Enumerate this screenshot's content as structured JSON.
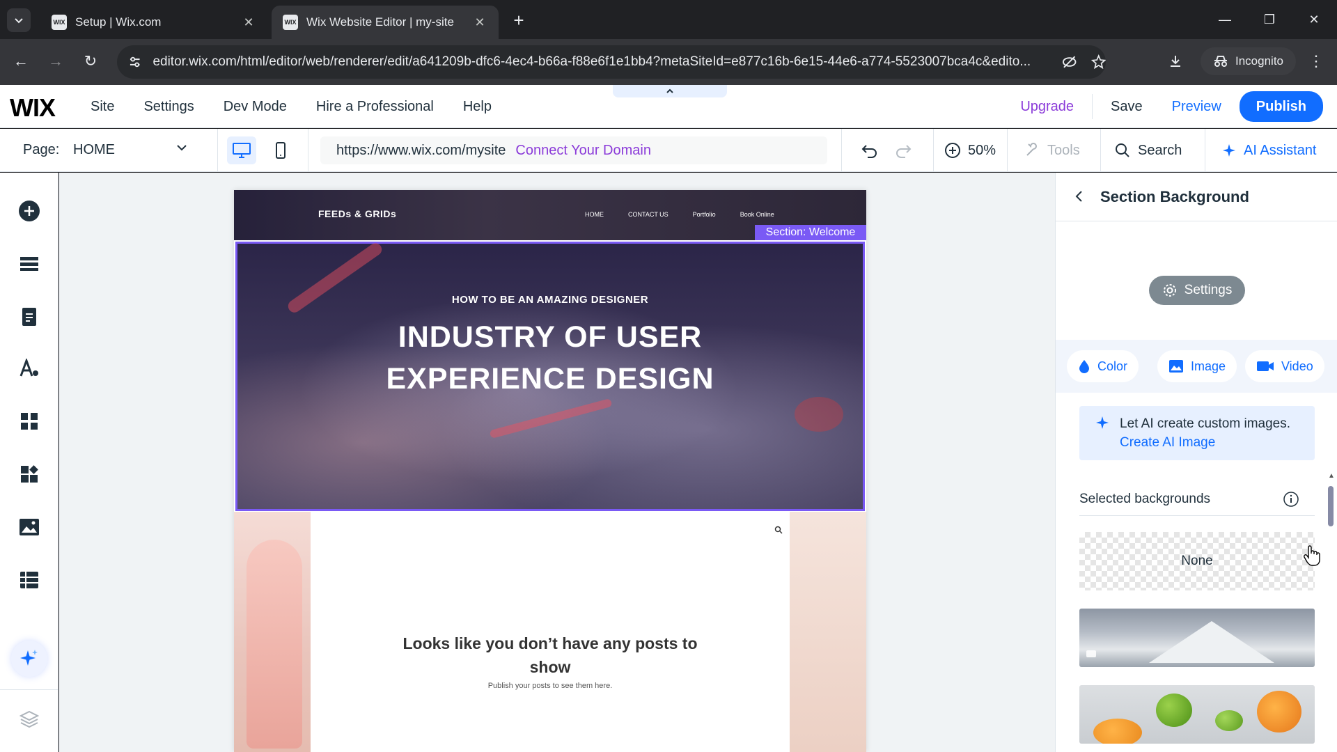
{
  "browser": {
    "tabs": [
      {
        "title": "Setup | Wix.com",
        "active": false
      },
      {
        "title": "Wix Website Editor | my-site",
        "active": true
      }
    ],
    "url": "editor.wix.com/html/editor/web/renderer/edit/a641209b-dfc6-4ec4-b66a-f88e6f1e1bb4?metaSiteId=e877c16b-6e15-44e6-a774-5523007bca4c&edito...",
    "incognito_label": "Incognito"
  },
  "wix_top": {
    "logo": "WIX",
    "menu": [
      "Site",
      "Settings",
      "Dev Mode",
      "Hire a Professional",
      "Help"
    ],
    "upgrade": "Upgrade",
    "save": "Save",
    "preview": "Preview",
    "publish": "Publish"
  },
  "wix_bar2": {
    "page_label": "Page:",
    "page_value": "HOME",
    "site_url": "https://www.wix.com/mysite",
    "connect_domain": "Connect Your Domain",
    "zoom": "50%",
    "tools": "Tools",
    "search": "Search",
    "ai_assistant": "AI Assistant"
  },
  "site": {
    "logo": "FEEDs & GRIDs",
    "nav": [
      "HOME",
      "CONTACT US",
      "Portfolio",
      "Book Online"
    ],
    "section_tag": "Section: Welcome",
    "hero_subtitle": "HOW TO BE AN AMAZING DESIGNER",
    "hero_title_line1": "INDUSTRY OF USER",
    "hero_title_line2": "EXPERIENCE DESIGN",
    "blog_empty_line1": "Looks like you don’t have any posts to",
    "blog_empty_line2": "show",
    "blog_empty_sub": "Publish your posts to see them here."
  },
  "panel": {
    "title": "Section Background",
    "settings_button": "Settings",
    "tabs": [
      "Color",
      "Image",
      "Video"
    ],
    "ai_text": "Let AI create custom images.",
    "ai_link": "Create AI Image",
    "selected_backgrounds_label": "Selected backgrounds",
    "none_label": "None"
  },
  "colors": {
    "accent": "#116dff",
    "upgrade": "#8b3bd9",
    "section_highlight": "#7a5af5"
  }
}
